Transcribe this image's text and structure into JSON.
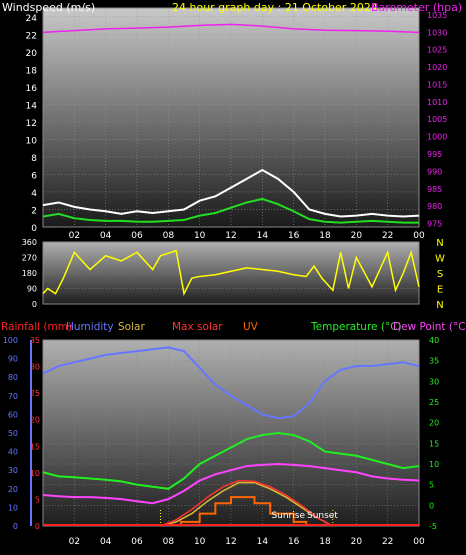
{
  "colors": {
    "background": "#000000",
    "wind_title": "#ffffff",
    "barometer": "#ee22ee",
    "wind_gust": "#ffffff",
    "wind_avg": "#22dd22",
    "wind_dir": "#ffff00",
    "rain": "#ff2222",
    "humidity": "#6677ff",
    "solar": "#ddbb33",
    "max_solar": "#ff3333",
    "uv": "#ff6600",
    "temperature": "#22ee22",
    "dewpoint": "#ff44ff",
    "axis_text": "#ffffff",
    "hum_axis": "#6677ff",
    "rain_axis": "#ff3333"
  },
  "chart_data": [
    {
      "type": "line",
      "title": "24 hour graph day : 21 October 2024",
      "left_label": "Windspeed (m/s)",
      "right_label": "Barometer (hpa)",
      "x_ticks": [
        "02",
        "04",
        "06",
        "08",
        "10",
        "12",
        "14",
        "16",
        "18",
        "20",
        "22",
        "00"
      ],
      "y_ticks": [
        "0",
        "2",
        "4",
        "6",
        "8",
        "10",
        "12",
        "14",
        "16",
        "18",
        "20",
        "22",
        "24"
      ],
      "baro_ticks": [
        "975",
        "980",
        "985",
        "990",
        "995",
        "1000",
        "1005",
        "1010",
        "1015",
        "1020",
        "1025",
        "1030",
        "1035"
      ],
      "ylim": [
        0,
        25
      ],
      "baro_lim": [
        974,
        1037
      ],
      "x_range": [
        0,
        24
      ],
      "grid": true,
      "series": [
        {
          "key": "barometer",
          "x": [
            0,
            2,
            4,
            6,
            8,
            10,
            12,
            14,
            16,
            18,
            20,
            22,
            24
          ],
          "values": [
            1030,
            1030.5,
            1031,
            1031.2,
            1031.5,
            1032,
            1032.3,
            1031.8,
            1031,
            1030.6,
            1030.5,
            1030.3,
            1030
          ]
        },
        {
          "key": "gust",
          "x": [
            0,
            1,
            2,
            3,
            4,
            5,
            6,
            7,
            8,
            9,
            10,
            11,
            12,
            13,
            14,
            15,
            16,
            17,
            18,
            19,
            20,
            21,
            22,
            23,
            24
          ],
          "values": [
            2.5,
            2.8,
            2.3,
            2,
            1.8,
            1.5,
            1.8,
            1.6,
            1.8,
            2,
            3,
            3.5,
            4.5,
            5.5,
            6.5,
            5.5,
            4,
            2,
            1.5,
            1.2,
            1.3,
            1.5,
            1.3,
            1.2,
            1.3
          ]
        },
        {
          "key": "avg",
          "x": [
            0,
            1,
            2,
            3,
            4,
            5,
            6,
            7,
            8,
            9,
            10,
            11,
            12,
            13,
            14,
            15,
            16,
            17,
            18,
            19,
            20,
            21,
            22,
            23,
            24
          ],
          "values": [
            1.2,
            1.5,
            1,
            0.8,
            0.7,
            0.7,
            0.6,
            0.6,
            0.7,
            0.8,
            1.3,
            1.6,
            2.2,
            2.8,
            3.2,
            2.6,
            1.8,
            0.9,
            0.6,
            0.5,
            0.6,
            0.7,
            0.6,
            0.5,
            0.5
          ]
        }
      ]
    },
    {
      "type": "line",
      "title": "",
      "y_ticks": [
        "0",
        "90",
        "180",
        "270",
        "360"
      ],
      "ylim": [
        0,
        360
      ],
      "compass": [
        "N",
        "W",
        "S",
        "E",
        "N"
      ],
      "series": [
        {
          "key": "direction",
          "x": [
            0,
            0.3,
            0.8,
            1.3,
            2,
            3,
            4,
            5,
            6,
            7,
            7.5,
            8.5,
            9,
            9.5,
            10,
            11,
            12,
            13,
            14,
            15,
            16,
            16.8,
            17.3,
            17.8,
            18.5,
            19,
            19.5,
            20,
            21,
            22,
            22.5,
            23,
            23.5,
            24
          ],
          "values": [
            60,
            90,
            60,
            150,
            300,
            200,
            280,
            250,
            300,
            200,
            280,
            310,
            60,
            150,
            160,
            170,
            190,
            210,
            200,
            190,
            170,
            160,
            220,
            150,
            80,
            300,
            90,
            270,
            100,
            300,
            80,
            180,
            300,
            100
          ]
        }
      ]
    },
    {
      "type": "line",
      "title": "",
      "legend": [
        "Rainfall (mm)",
        "Humidity",
        "Solar",
        "Max solar",
        "UV",
        "Temperature (°C)",
        "Dew Point (°C)"
      ],
      "hum_ticks": [
        "0",
        "10",
        "20",
        "30",
        "40",
        "50",
        "60",
        "70",
        "80",
        "90",
        "100"
      ],
      "rain_ticks": [
        "0",
        "5",
        "10",
        "15",
        "20",
        "25",
        "30",
        "35"
      ],
      "temp_ticks": [
        "-5",
        "0",
        "5",
        "10",
        "15",
        "20",
        "25",
        "30",
        "35",
        "40"
      ],
      "x_ticks": [
        "02",
        "04",
        "06",
        "08",
        "10",
        "12",
        "14",
        "16",
        "18",
        "20",
        "22",
        "00"
      ],
      "temp_lim": [
        -5,
        40
      ],
      "sunrise_label": "Sunrise",
      "sunset_label": "Sunset",
      "sunrise": 7.5,
      "sunset": 18.5,
      "grid": true,
      "series": [
        {
          "key": "humidity",
          "x": [
            0,
            1,
            2,
            3,
            4,
            5,
            6,
            7,
            8,
            9,
            10,
            11,
            12,
            13,
            14,
            15,
            16,
            17,
            18,
            19,
            20,
            21,
            22,
            23,
            24
          ],
          "values": [
            82,
            86,
            88,
            90,
            92,
            93,
            94,
            95,
            96,
            94,
            85,
            76,
            70,
            65,
            60,
            58,
            59,
            66,
            78,
            84,
            86,
            86,
            87,
            88,
            86
          ]
        },
        {
          "key": "temperature",
          "x": [
            0,
            1,
            2,
            3,
            4,
            5,
            6,
            7,
            8,
            9,
            10,
            11,
            12,
            13,
            14,
            15,
            16,
            17,
            18,
            19,
            20,
            21,
            22,
            23,
            24
          ],
          "values": [
            8,
            7,
            6.8,
            6.5,
            6.2,
            5.8,
            5,
            4.5,
            4,
            6.5,
            10,
            12,
            14,
            16,
            17,
            17.5,
            17,
            15.5,
            13,
            12.5,
            12,
            11,
            10,
            9,
            9.5
          ]
        },
        {
          "key": "dewpoint",
          "x": [
            0,
            1,
            2,
            3,
            4,
            5,
            6,
            7,
            8,
            9,
            10,
            11,
            12,
            13,
            14,
            15,
            16,
            17,
            18,
            19,
            20,
            21,
            22,
            23,
            24
          ],
          "values": [
            2.5,
            2.2,
            2,
            2,
            1.8,
            1.5,
            1,
            0.5,
            1.5,
            3.5,
            6,
            7.5,
            8.5,
            9.5,
            9.8,
            10,
            9.8,
            9.5,
            9,
            8.5,
            8,
            7,
            6.5,
            6.2,
            6
          ]
        },
        {
          "key": "solar",
          "x": [
            7.5,
            8.5,
            9.5,
            10.5,
            11.5,
            12.5,
            13.5,
            14.5,
            15.5,
            16.5,
            17.5,
            18.5
          ],
          "values": [
            -5,
            -4,
            -2,
            1,
            3.5,
            5.5,
            5.5,
            4,
            2,
            -0.5,
            -3,
            -5
          ]
        },
        {
          "key": "max_solar",
          "x": [
            7.5,
            8.5,
            9.5,
            10.5,
            11.5,
            12.5,
            13.5,
            14.5,
            15.5,
            16.5,
            17.5,
            18.5
          ],
          "values": [
            -5,
            -3.5,
            -1,
            2,
            4.5,
            6,
            5.8,
            4.5,
            2.5,
            0,
            -3,
            -5
          ]
        },
        {
          "key": "uv",
          "x": [
            8.8,
            8.8,
            10,
            10,
            11,
            11,
            12,
            12,
            13.5,
            13.5,
            14.5,
            14.5,
            16,
            16,
            16.8,
            16.8
          ],
          "values": [
            -5,
            -4,
            -4,
            -2,
            -2,
            0.5,
            0.5,
            2,
            2,
            0.5,
            0.5,
            -2,
            -2,
            -4,
            -4,
            -5
          ]
        }
      ]
    }
  ]
}
